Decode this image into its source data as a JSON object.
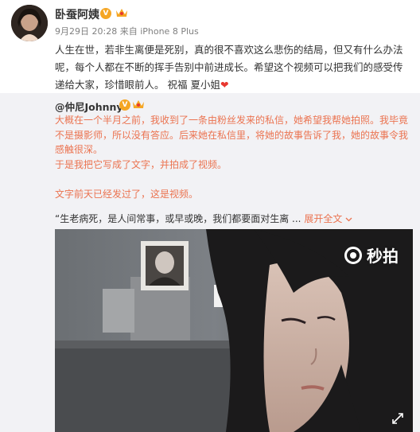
{
  "post": {
    "author": "卧蚕阿姨",
    "timestamp": "9月29日 20:28",
    "source": "来自 iPhone 8 Plus",
    "text_lines": [
      "人生在世，若非生离便是死别，真的很不喜欢这么悲伤的结局，但又有什么办法",
      "呢，每个人都在不断的挥手告别中前进成长。希望这个视频可以把我们的感受传",
      "递给大家，珍惜眼前人。 祝福 夏小姐"
    ],
    "heart": "❤"
  },
  "repost": {
    "author": "@仲尼Johnny",
    "paragraphs": [
      "大概在一个半月之前，我收到了一条由粉丝发来的私信，她希望我帮她拍照。我毕竟",
      "不是摄影师，所以没有答应。后来她在私信里，将她的故事告诉了我，她的故事令我",
      "感触很深。",
      "于是我把它写成了文字，并拍成了视频。",
      "",
      "文字前天已经发过了，这是视频。",
      ""
    ],
    "quote": "“生老病死，是人间常事，或早或晚，我们都要面对生离 ...",
    "expand_label": "展开全文",
    "expand_icon": "chevron-down-icon"
  },
  "video": {
    "watermark": "秒拍",
    "watermark_icon": "miaopai-logo-icon",
    "fullscreen_icon": "fullscreen-icon"
  },
  "colors": {
    "link": "#eb7350",
    "repost_bg": "#f2f2f5",
    "badge": "#f5a623",
    "heart": "#e8372f"
  }
}
